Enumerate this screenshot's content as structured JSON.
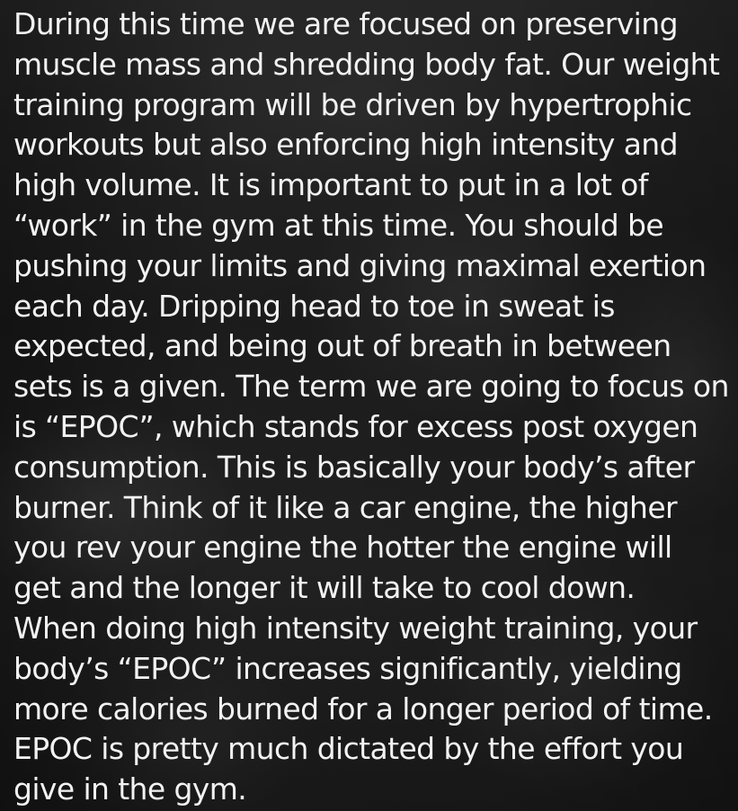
{
  "body_text": "During this time we are focused on preserving\nmuscle mass and shredding body fat. Our weight\ntraining program will be driven by hypertrophic\nworkouts but also enforcing high intensity and\nhigh volume. It is important to put in a lot of\n“work” in the gym at this time. You should be\npushing your limits and giving maximal exertion\neach day. Dripping head to toe in sweat is\nexpected, and being out of breath in between\nsets is a given. The term we are going to focus on\nis “EPOC”, which stands for excess post oxygen\nconsumption. This is basically your body’s after\nburner. Think of it like a car engine, the higher\nyou rev your engine the hotter the engine will\nget and the longer it will take to cool down.\nWhen doing high intensity weight training, your\nbody’s “EPOC” increases significantly, yielding\nmore calories burned for a longer period of time.\nEPOC is pretty much dictated by the effort you\ngive in the gym.",
  "colors": {
    "text": "#f2f2f2",
    "background": "#1a1a1a"
  }
}
